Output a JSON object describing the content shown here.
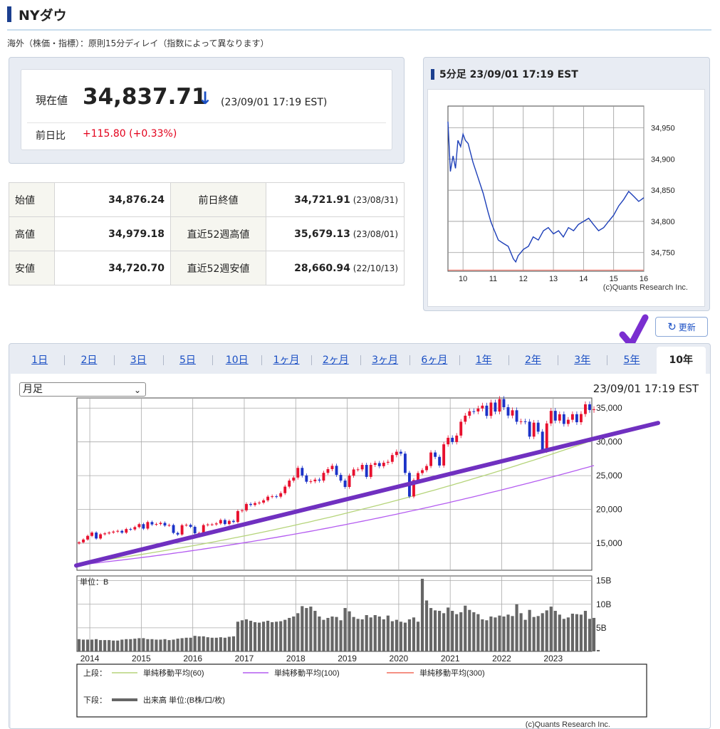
{
  "header": {
    "title": "NYダウ"
  },
  "note": "海外（株価・指標）：原則15分ディレイ（指数によって異なります）",
  "price": {
    "label": "現在値",
    "value": "34,837.71",
    "arrow": "↓",
    "time": "(23/09/01 17:19 EST)",
    "change_label": "前日比",
    "change": "+115.80 (+0.33%)"
  },
  "stats": [
    {
      "k1": "始値",
      "v1": "34,876.24",
      "k2": "前日終値",
      "v2": "34,721.91",
      "d2": "(23/08/31)"
    },
    {
      "k1": "高値",
      "v1": "34,979.18",
      "k2": "直近52週高値",
      "v2": "35,679.13",
      "d2": "(23/08/01)"
    },
    {
      "k1": "安値",
      "v1": "34,720.70",
      "k2": "直近52週安値",
      "v2": "28,660.94",
      "d2": "(22/10/13)"
    }
  ],
  "intraday": {
    "title": "5分足 23/09/01 17:19 EST",
    "credit": "(c)Quants Research Inc."
  },
  "refresh_label": "更新",
  "tabs": [
    "1日",
    "2日",
    "3日",
    "5日",
    "10日",
    "1ヶ月",
    "2ヶ月",
    "3ヶ月",
    "6ヶ月",
    "1年",
    "2年",
    "3年",
    "5年",
    "10年"
  ],
  "active_tab": "10年",
  "main_chart": {
    "period_select": "月足",
    "timestamp": "23/09/01 17:19 EST",
    "volume_unit_label": "単位：B",
    "legend": {
      "upper_label": "上段：",
      "lower_label": "下段：",
      "ma60": "単純移動平均(60)",
      "ma100": "単純移動平均(100)",
      "ma300": "単純移動平均(300)",
      "volume": "出来高 単位:(B株/口/枚)"
    },
    "credit": "(c)Quants Research Inc.",
    "colors": {
      "up": "#e8102e",
      "down": "#1c33c8",
      "ma60": "#b5d47a",
      "ma100": "#b45cf0",
      "ma300": "#f26b5b",
      "volume": "#666666",
      "trendline": "#7030c0",
      "annotation_check": "#7a2ed0"
    }
  },
  "chart_data": [
    {
      "type": "line",
      "title": "5分足 23/09/01 17:19 EST",
      "x_ticks": [
        "10",
        "11",
        "12",
        "13",
        "14",
        "15",
        "16"
      ],
      "y_ticks": [
        "34,750",
        "34,800",
        "34,850",
        "34,900",
        "34,950"
      ],
      "ylim": [
        34720,
        34985
      ],
      "xlim": [
        9.5,
        16
      ],
      "reference_line": 34721.91,
      "x": [
        9.5,
        9.58,
        9.67,
        9.75,
        9.83,
        9.92,
        10.0,
        10.08,
        10.17,
        10.25,
        10.33,
        10.5,
        10.67,
        10.83,
        10.92,
        11.0,
        11.17,
        11.33,
        11.5,
        11.67,
        11.75,
        11.83,
        11.92,
        12.0,
        12.17,
        12.33,
        12.5,
        12.67,
        12.83,
        13.0,
        13.17,
        13.33,
        13.5,
        13.67,
        13.83,
        14.0,
        14.17,
        14.33,
        14.5,
        14.67,
        14.83,
        15.0,
        15.17,
        15.33,
        15.5,
        15.67,
        15.83,
        15.92,
        16.0
      ],
      "y": [
        34960,
        34880,
        34905,
        34885,
        34930,
        34920,
        34940,
        34930,
        34925,
        34910,
        34895,
        34870,
        34845,
        34815,
        34800,
        34790,
        34770,
        34765,
        34760,
        34740,
        34735,
        34745,
        34750,
        34755,
        34760,
        34775,
        34770,
        34785,
        34790,
        34780,
        34785,
        34775,
        34790,
        34785,
        34795,
        34800,
        34805,
        34795,
        34785,
        34790,
        34800,
        34810,
        34825,
        34835,
        34848,
        34840,
        34832,
        34835,
        34838
      ],
      "grid": true
    },
    {
      "type": "candlestick",
      "title": "",
      "period": "月足",
      "x_ticks": [
        "2014",
        "2015",
        "2016",
        "2017",
        "2018",
        "2019",
        "2020",
        "2021",
        "2022",
        "2023"
      ],
      "y_ticks": [
        "15,000",
        "20,000",
        "25,000",
        "30,000",
        "35,000"
      ],
      "ylim": [
        11000,
        36500
      ],
      "xlim": [
        "2013-09",
        "2023-09"
      ],
      "closes": [
        15130,
        15546,
        16086,
        16577,
        15699,
        16322,
        16458,
        16581,
        16717,
        16827,
        16563,
        17098,
        17042,
        17391,
        17823,
        17165,
        18133,
        17776,
        17840,
        18011,
        17620,
        17690,
        16528,
        16285,
        17664,
        17720,
        17425,
        16466,
        16517,
        17685,
        17774,
        17787,
        17930,
        18432,
        17840,
        18308,
        18142,
        19762,
        19864,
        20812,
        20663,
        20941,
        21009,
        21350,
        21891,
        21948,
        21891,
        22405,
        23377,
        24272,
        24719,
        26149,
        25029,
        24103,
        24163,
        24415,
        24271,
        25415,
        25965,
        26458,
        25116,
        24270,
        23327,
        25000,
        25916,
        25929,
        26593,
        24815,
        26600,
        26864,
        26403,
        26917,
        27046,
        28051,
        28538,
        28256,
        25409,
        21917,
        24346,
        25383,
        25813,
        26428,
        28430,
        27782,
        26502,
        29639,
        30606,
        29983,
        30932,
        32982,
        33875,
        34529,
        34503,
        34935,
        35361,
        33844,
        35820,
        34484,
        36338,
        35131,
        33893,
        34678,
        32977,
        33035,
        32990,
        30775,
        32845,
        31510,
        28726,
        32733,
        34590,
        33147,
        34086,
        32657,
        33274,
        34098,
        32908,
        34123,
        35560,
        34721,
        34838
      ],
      "ma60_range": [
        12000,
        30300
      ],
      "ma100_range": [
        11800,
        26500
      ],
      "volume_ticks": [
        "5B",
        "10B",
        "15B"
      ],
      "volume_ylim": [
        0,
        16
      ],
      "volume_B": [
        2.6,
        2.5,
        2.5,
        2.5,
        2.6,
        2.4,
        2.4,
        2.4,
        2.3,
        2.3,
        2.5,
        2.6,
        2.6,
        2.7,
        2.8,
        2.8,
        2.6,
        2.6,
        2.5,
        2.5,
        2.6,
        2.4,
        2.5,
        2.7,
        2.8,
        2.9,
        2.9,
        3.3,
        3.2,
        3.2,
        3.0,
        2.9,
        2.9,
        3.0,
        2.9,
        3.1,
        3.2,
        6.3,
        6.6,
        6.8,
        6.5,
        6.2,
        6.1,
        6.3,
        6.5,
        6.2,
        6.3,
        6.4,
        6.7,
        7.1,
        7.4,
        8.1,
        9.6,
        9.2,
        9.5,
        8.6,
        7.4,
        6.7,
        7.1,
        7.4,
        7.3,
        6.6,
        9.2,
        8.5,
        7.3,
        6.9,
        6.8,
        7.7,
        7.2,
        7.7,
        7.4,
        6.8,
        7.6,
        6.4,
        6.7,
        6.3,
        6.1,
        6.8,
        7.2,
        6.3,
        15.4,
        10.8,
        9.2,
        8.7,
        8.6,
        8.1,
        9.3,
        8.6,
        7.9,
        8.3,
        9.7,
        8.8,
        8.3,
        7.9,
        6.8,
        6.6,
        7.4,
        7.2,
        7.6,
        7.4,
        7.8,
        7.5,
        10.0,
        8.1,
        6.7,
        8.8,
        7.3,
        7.5,
        8.1,
        8.7,
        9.5,
        8.6,
        7.8,
        6.9,
        7.2,
        8.0,
        7.9,
        7.8,
        8.6,
        6.9,
        7.1,
        0.3
      ]
    }
  ]
}
